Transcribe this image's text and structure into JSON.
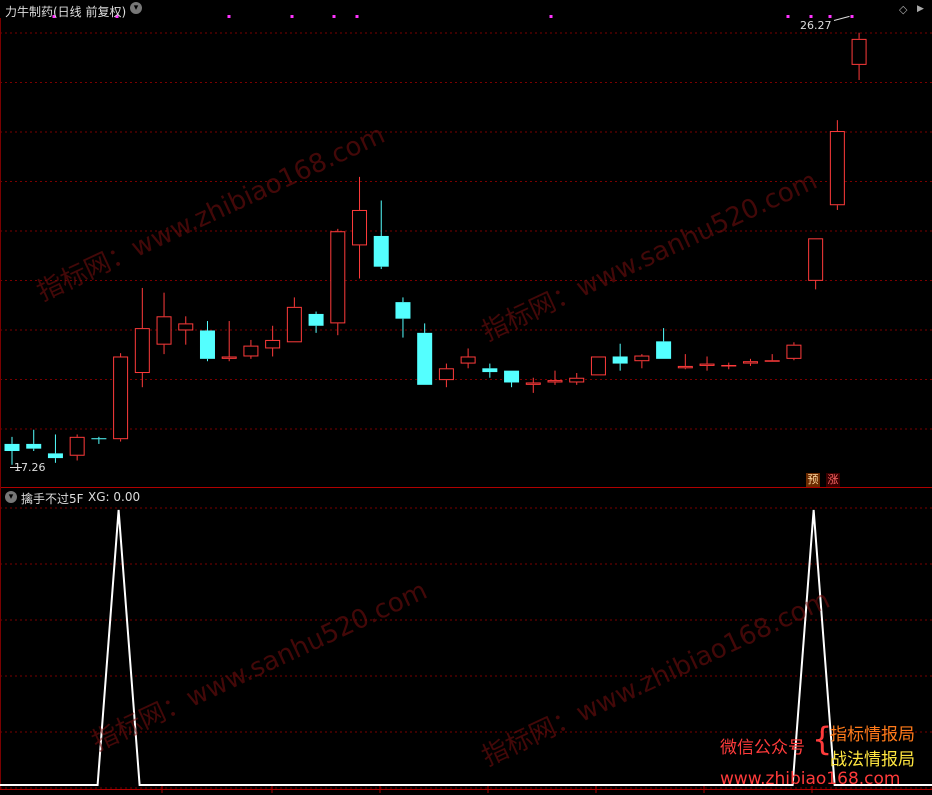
{
  "header": {
    "title": "力牛制药(日线 前复权)",
    "collapse_icon": "chevron-down-icon"
  },
  "indicator": {
    "name": "擒手不过5F",
    "xg_label": "XG: 0.00"
  },
  "controls": {
    "diamond": "◇",
    "more": "▶"
  },
  "markers": {
    "pre": "预",
    "rise": "涨"
  },
  "price_labels": {
    "high": "26.27",
    "low": "17.26"
  },
  "watermarks": [
    "指标网：www.zhibiao168.com",
    "指标网：www.sanhu520.com"
  ],
  "promo": {
    "wechat": "微信公众号",
    "brace": "{",
    "name1": "指标情报局",
    "name2": "战法情报局",
    "url": "www.zhibiao168.com"
  },
  "colors": {
    "up": "#ff3b3b",
    "down": "#54ffff",
    "grid": "#7a0000",
    "signal": "#ffffff",
    "dots": "#ff33ff"
  },
  "chart_data": {
    "type": "candlestick",
    "candles": [
      {
        "o": 17.7,
        "c": 17.55,
        "h": 17.85,
        "l": 17.26
      },
      {
        "o": 17.7,
        "c": 17.6,
        "h": 18.0,
        "l": 17.55
      },
      {
        "o": 17.5,
        "c": 17.4,
        "h": 17.9,
        "l": 17.3
      },
      {
        "o": 17.45,
        "c": 17.85,
        "h": 17.9,
        "l": 17.35
      },
      {
        "o": 17.82,
        "c": 17.8,
        "h": 17.85,
        "l": 17.7
      },
      {
        "o": 17.8,
        "c": 19.55,
        "h": 19.62,
        "l": 17.75
      },
      {
        "o": 19.2,
        "c": 20.15,
        "h": 21.0,
        "l": 18.9
      },
      {
        "o": 19.8,
        "c": 20.4,
        "h": 20.9,
        "l": 19.6
      },
      {
        "o": 20.1,
        "c": 20.25,
        "h": 20.4,
        "l": 19.8
      },
      {
        "o": 20.1,
        "c": 19.5,
        "h": 20.3,
        "l": 19.45
      },
      {
        "o": 19.5,
        "c": 19.55,
        "h": 20.3,
        "l": 19.45
      },
      {
        "o": 19.55,
        "c": 19.78,
        "h": 19.9,
        "l": 19.5
      },
      {
        "o": 19.72,
        "c": 19.9,
        "h": 20.2,
        "l": 19.55
      },
      {
        "o": 19.85,
        "c": 20.6,
        "h": 20.8,
        "l": 19.85
      },
      {
        "o": 20.45,
        "c": 20.2,
        "h": 20.5,
        "l": 20.05
      },
      {
        "o": 20.25,
        "c": 22.2,
        "h": 22.25,
        "l": 20.0
      },
      {
        "o": 21.9,
        "c": 22.65,
        "h": 23.35,
        "l": 21.2
      },
      {
        "o": 22.1,
        "c": 21.45,
        "h": 22.85,
        "l": 21.4
      },
      {
        "o": 20.7,
        "c": 20.35,
        "h": 20.8,
        "l": 19.95
      },
      {
        "o": 20.05,
        "c": 18.95,
        "h": 20.25,
        "l": 18.95
      },
      {
        "o": 19.05,
        "c": 19.3,
        "h": 19.4,
        "l": 18.9
      },
      {
        "o": 19.4,
        "c": 19.55,
        "h": 19.72,
        "l": 19.3
      },
      {
        "o": 19.3,
        "c": 19.22,
        "h": 19.4,
        "l": 19.1
      },
      {
        "o": 19.25,
        "c": 19.0,
        "h": 19.25,
        "l": 18.9
      },
      {
        "o": 18.95,
        "c": 19.0,
        "h": 19.1,
        "l": 18.78
      },
      {
        "o": 19.0,
        "c": 19.05,
        "h": 19.25,
        "l": 18.95
      },
      {
        "o": 19.0,
        "c": 19.1,
        "h": 19.2,
        "l": 18.95
      },
      {
        "o": 19.15,
        "c": 19.55,
        "h": 19.55,
        "l": 19.15
      },
      {
        "o": 19.55,
        "c": 19.4,
        "h": 19.82,
        "l": 19.25
      },
      {
        "o": 19.45,
        "c": 19.57,
        "h": 19.6,
        "l": 19.3
      },
      {
        "o": 19.87,
        "c": 19.5,
        "h": 20.15,
        "l": 19.5
      },
      {
        "o": 19.3,
        "c": 19.35,
        "h": 19.6,
        "l": 19.28
      },
      {
        "o": 19.35,
        "c": 19.4,
        "h": 19.55,
        "l": 19.25
      },
      {
        "o": 19.35,
        "c": 19.37,
        "h": 19.42,
        "l": 19.28
      },
      {
        "o": 19.4,
        "c": 19.45,
        "h": 19.5,
        "l": 19.35
      },
      {
        "o": 19.45,
        "c": 19.47,
        "h": 19.6,
        "l": 19.45
      },
      {
        "o": 19.5,
        "c": 19.8,
        "h": 19.85,
        "l": 19.47
      },
      {
        "o": 21.15,
        "c": 22.05,
        "h": 22.05,
        "l": 20.97
      },
      {
        "o": 22.75,
        "c": 24.32,
        "h": 24.55,
        "l": 22.65
      },
      {
        "o": 25.72,
        "c": 26.27,
        "h": 26.4,
        "l": 25.4
      }
    ],
    "price_range": [
      17.0,
      26.5
    ],
    "signal": [
      0,
      0,
      0,
      0,
      0,
      0,
      0,
      0,
      0,
      0,
      0,
      0,
      0,
      0,
      0,
      0,
      0,
      0,
      0,
      0,
      0,
      0,
      0,
      0,
      0,
      0,
      0,
      0,
      0,
      0,
      0,
      0,
      0,
      0,
      0,
      0,
      0,
      0,
      0,
      0
    ],
    "signal_peaks": [
      {
        "x": 5,
        "value": 1
      },
      {
        "x": 37,
        "value": 1
      }
    ],
    "grid": true
  }
}
